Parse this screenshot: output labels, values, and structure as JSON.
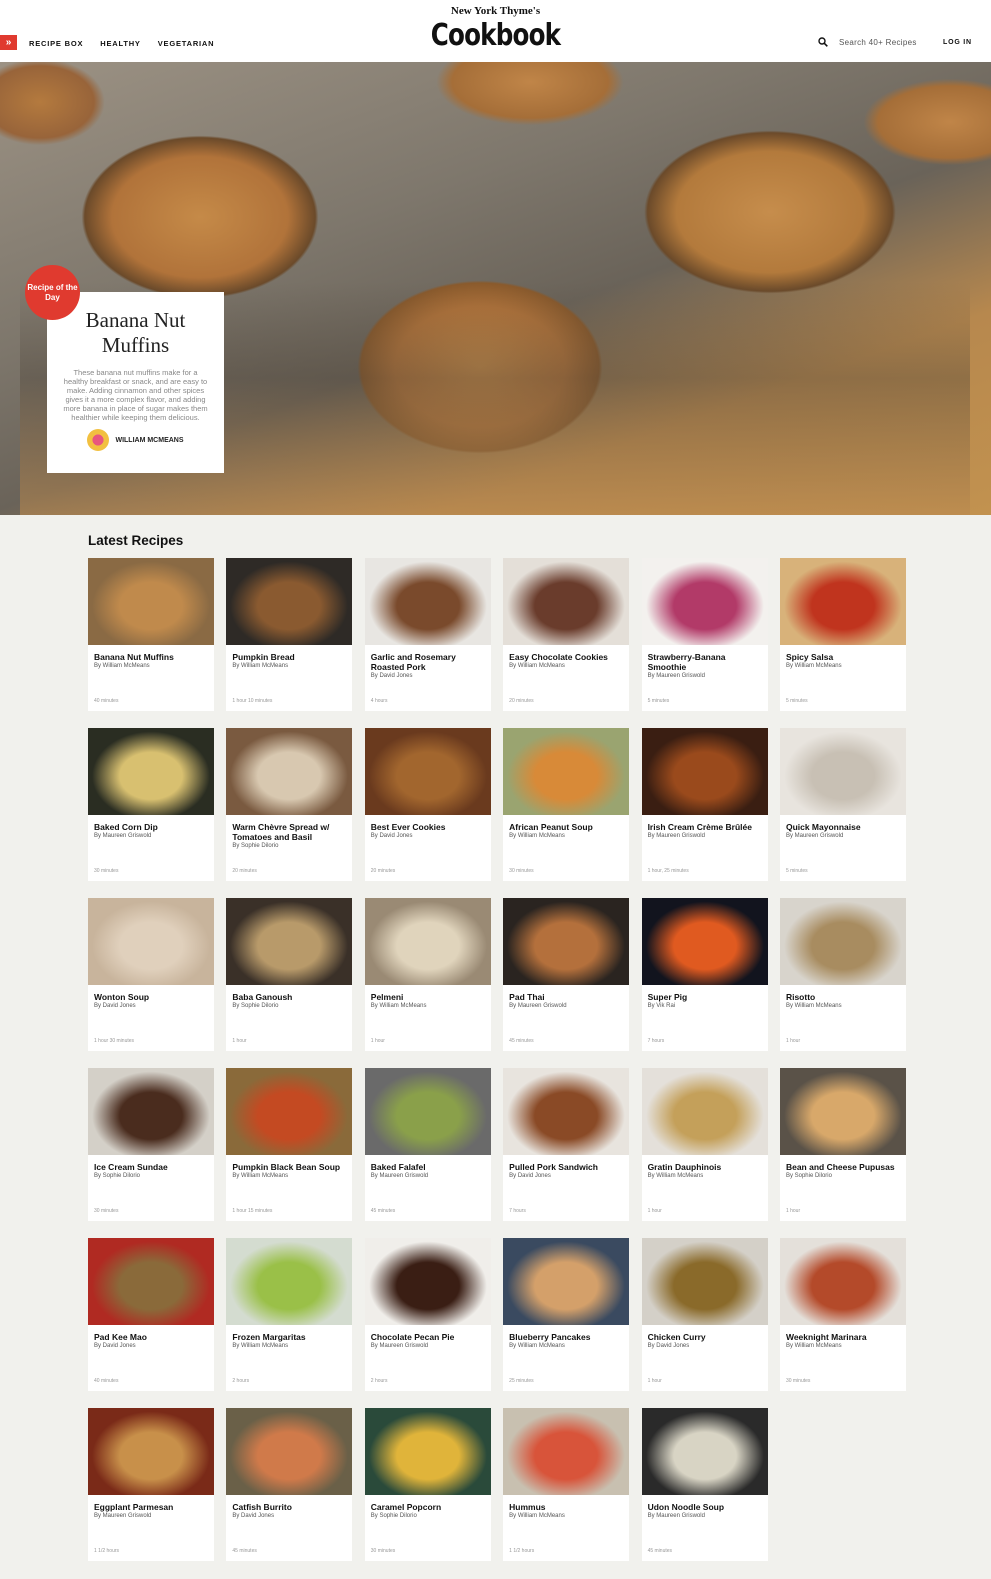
{
  "header": {
    "menu_icon": "double-chevron-right-icon",
    "nav": [
      "RECIPE BOX",
      "HEALTHY",
      "VEGETARIAN"
    ],
    "brand_small": "New York Thyme's",
    "brand_big": "Cookbook",
    "search_icon": "search-icon",
    "search_placeholder": "Search 40+ Recipes",
    "login": "LOG IN"
  },
  "hero": {
    "badge": "Recipe of the Day",
    "title": "Banana Nut Muffins",
    "description": "These banana nut muffins make for a healthy breakfast or snack, and are easy to make. Adding cinnamon and other spices gives it a more complex flavor, and adding more banana in place of sugar makes them healthier while keeping them delicious.",
    "author": "WILLIAM MCMEANS"
  },
  "section_title": "Latest Recipes",
  "recipes": [
    {
      "name": "Banana Nut Muffins",
      "by": "By William McMeans",
      "time": "40 minutes",
      "c1": "#8a6a44",
      "c2": "#c08a4c"
    },
    {
      "name": "Pumpkin Bread",
      "by": "By William McMeans",
      "time": "1 hour 10 minutes",
      "c1": "#2e2a26",
      "c2": "#8a5a30"
    },
    {
      "name": "Garlic and Rosemary Roasted Pork",
      "by": "By David Jones",
      "time": "4 hours",
      "c1": "#e8e6e2",
      "c2": "#7a4a2c"
    },
    {
      "name": "Easy Chocolate Cookies",
      "by": "By William McMeans",
      "time": "20 minutes",
      "c1": "#e4dfd8",
      "c2": "#6a3c2c"
    },
    {
      "name": "Strawberry-Banana Smoothie",
      "by": "By Maureen Griswold",
      "time": "5 minutes",
      "c1": "#f3f1ee",
      "c2": "#b23a68"
    },
    {
      "name": "Spicy Salsa",
      "by": "By William McMeans",
      "time": "5 minutes",
      "c1": "#d8b27a",
      "c2": "#c0341e"
    },
    {
      "name": "Baked Corn Dip",
      "by": "By Maureen Griswold",
      "time": "30 minutes",
      "c1": "#2a2d22",
      "c2": "#d8c070"
    },
    {
      "name": "Warm Chèvre Spread w/ Tomatoes and Basil",
      "by": "By Sophie Dilorio",
      "time": "20 minutes",
      "c1": "#7a5a40",
      "c2": "#d8c8b0"
    },
    {
      "name": "Best Ever Cookies",
      "by": "By David Jones",
      "time": "20 minutes",
      "c1": "#6a3a1e",
      "c2": "#a2662e"
    },
    {
      "name": "African Peanut Soup",
      "by": "By William McMeans",
      "time": "30 minutes",
      "c1": "#9aa470",
      "c2": "#d88a38"
    },
    {
      "name": "Irish Cream Crème Brûlée",
      "by": "By Maureen Griswold",
      "time": "1 hour, 25 minutes",
      "c1": "#3a1e12",
      "c2": "#9a4a1c"
    },
    {
      "name": "Quick Mayonnaise",
      "by": "By Maureen Griswold",
      "time": "5 minutes",
      "c1": "#e8e4de",
      "c2": "#c8c0b4"
    },
    {
      "name": "Wonton Soup",
      "by": "By David Jones",
      "time": "1 hour 30 minutes",
      "c1": "#c8b49c",
      "c2": "#e0d0bc"
    },
    {
      "name": "Baba Ganoush",
      "by": "By Sophie Dilorio",
      "time": "1 hour",
      "c1": "#3a3028",
      "c2": "#b89a6a"
    },
    {
      "name": "Pelmeni",
      "by": "By William McMeans",
      "time": "1 hour",
      "c1": "#9a8a74",
      "c2": "#e0d4bc"
    },
    {
      "name": "Pad Thai",
      "by": "By Maureen Griswold",
      "time": "45 minutes",
      "c1": "#2a2420",
      "c2": "#b4703c"
    },
    {
      "name": "Super Pig",
      "by": "By Vik Rai",
      "time": "7 hours",
      "c1": "#12141e",
      "c2": "#e05a20"
    },
    {
      "name": "Risotto",
      "by": "By William McMeans",
      "time": "1 hour",
      "c1": "#d8d4cc",
      "c2": "#a88c60"
    },
    {
      "name": "Ice Cream Sundae",
      "by": "By Sophie Dilorio",
      "time": "30 minutes",
      "c1": "#d4d0c8",
      "c2": "#4a2c1e"
    },
    {
      "name": "Pumpkin Black Bean Soup",
      "by": "By William McMeans",
      "time": "1 hour 15 minutes",
      "c1": "#8a6a3a",
      "c2": "#c44a22"
    },
    {
      "name": "Baked Falafel",
      "by": "By Maureen Griswold",
      "time": "45 minutes",
      "c1": "#6a6a6a",
      "c2": "#8aa04a"
    },
    {
      "name": "Pulled Pork Sandwich",
      "by": "By David Jones",
      "time": "7 hours",
      "c1": "#e8e4de",
      "c2": "#8a4a26"
    },
    {
      "name": "Gratin Dauphinois",
      "by": "By William McMeans",
      "time": "1 hour",
      "c1": "#e4e0da",
      "c2": "#c4a05a"
    },
    {
      "name": "Bean and Cheese Pupusas",
      "by": "By Sophie Dilorio",
      "time": "1 hour",
      "c1": "#5a5248",
      "c2": "#d8a86a"
    },
    {
      "name": "Pad Kee Mao",
      "by": "By David Jones",
      "time": "40 minutes",
      "c1": "#b02a22",
      "c2": "#8a6a3a"
    },
    {
      "name": "Frozen Margaritas",
      "by": "By William McMeans",
      "time": "2 hours",
      "c1": "#d4dcd0",
      "c2": "#9ac048"
    },
    {
      "name": "Chocolate Pecan Pie",
      "by": "By Maureen Griswold",
      "time": "2 hours",
      "c1": "#f0eeea",
      "c2": "#3a1e14"
    },
    {
      "name": "Blueberry Pancakes",
      "by": "By William McMeans",
      "time": "25 minutes",
      "c1": "#3a4a60",
      "c2": "#d4a06a"
    },
    {
      "name": "Chicken Curry",
      "by": "By David Jones",
      "time": "1 hour",
      "c1": "#d4d0c8",
      "c2": "#8a6a2a"
    },
    {
      "name": "Weeknight Marinara",
      "by": "By William McMeans",
      "time": "30 minutes",
      "c1": "#e4e0da",
      "c2": "#b44a2a"
    },
    {
      "name": "Eggplant Parmesan",
      "by": "By Maureen Griswold",
      "time": "1 1/2 hours",
      "c1": "#7a2a18",
      "c2": "#c8904a"
    },
    {
      "name": "Catfish Burrito",
      "by": "By David Jones",
      "time": "45 minutes",
      "c1": "#6a6048",
      "c2": "#d07a4a"
    },
    {
      "name": "Caramel Popcorn",
      "by": "By Sophie Dilorio",
      "time": "30 minutes",
      "c1": "#2a4a3a",
      "c2": "#e0b43a"
    },
    {
      "name": "Hummus",
      "by": "By William McMeans",
      "time": "1 1/2 hours",
      "c1": "#c8c0b0",
      "c2": "#d8543a"
    },
    {
      "name": "Udon Noodle Soup",
      "by": "By Maureen Griswold",
      "time": "45 minutes",
      "c1": "#2a2a2a",
      "c2": "#d8d4c4"
    }
  ]
}
